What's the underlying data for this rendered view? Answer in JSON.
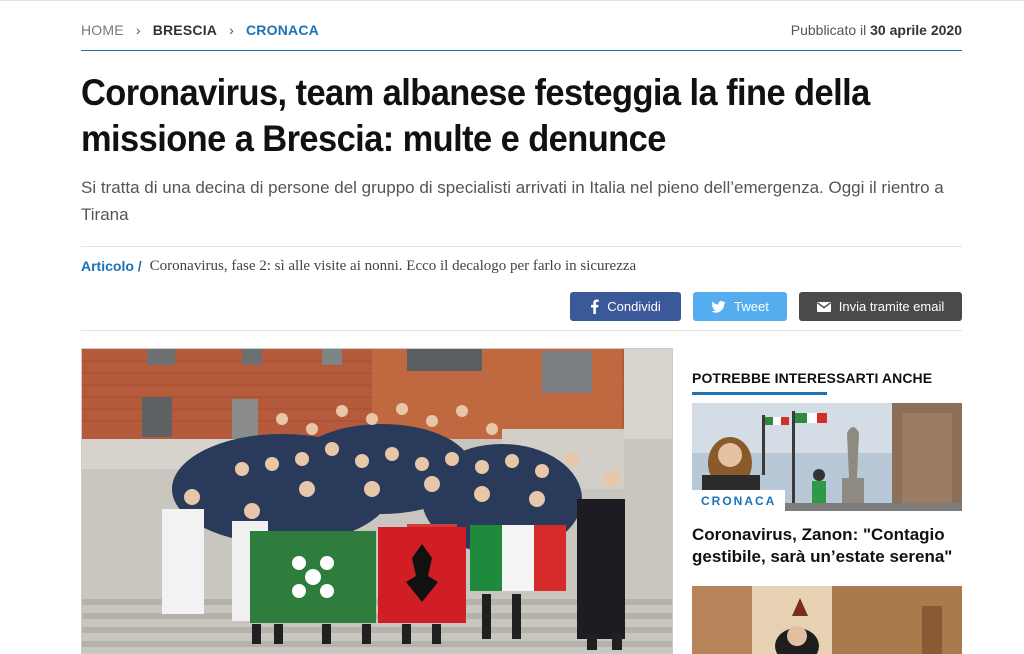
{
  "breadcrumb": {
    "home": "HOME",
    "section": "BRESCIA",
    "category": "CRONACA",
    "separator": "›"
  },
  "published": {
    "prefix": "Pubblicato il",
    "date": "30 aprile 2020"
  },
  "article": {
    "headline": "Coronavirus, team albanese festeggia la fine della missione a Brescia: multe e denunce",
    "subtitle": "Si tratta di una decina di persone del gruppo di specialisti arrivati in Italia nel pieno dell’emergenza. Oggi il rientro a Tirana"
  },
  "related": {
    "label": "Articolo /",
    "text": "Coronavirus, fase 2: sì alle visite ai nonni. Ecco il decalogo per farlo in sicurezza"
  },
  "share": {
    "facebook": "Condividi",
    "twitter": "Tweet",
    "email": "Invia tramite email"
  },
  "sidebar": {
    "title": "POTREBBE INTERESSARTI ANCHE",
    "card1": {
      "tag": "CRONACA",
      "title": "Coronavirus, Zanon: \"Contagio gestibile, sarà un’estate serena\""
    }
  },
  "colors": {
    "accent": "#1a73b8",
    "facebook": "#3b5998",
    "twitter": "#55acee",
    "email": "#4a4a4a"
  },
  "icons": {
    "facebook": "facebook-icon",
    "twitter": "twitter-icon",
    "email": "envelope-icon"
  }
}
